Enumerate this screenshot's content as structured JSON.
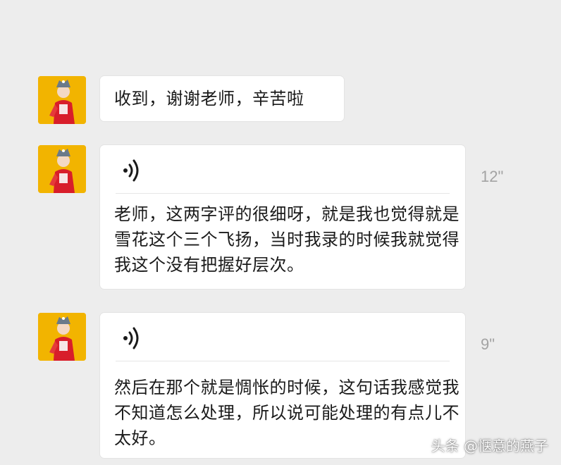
{
  "messages": [
    {
      "kind": "text",
      "text": "收到，谢谢老师，辛苦啦"
    },
    {
      "kind": "voice",
      "duration": "12\"",
      "transcript": [
        "老师，这两字评的很细呀，就是我也觉得就是",
        "雪花这个三个飞扬，当时我录的时候我就觉得",
        "我这个没有把握好层次。"
      ]
    },
    {
      "kind": "voice",
      "duration": "9\"",
      "transcript": [
        "然后在那个就是惆怅的时候，这句话我感觉我",
        "不知道怎么处理，所以说可能处理的有点儿不",
        "太好。"
      ]
    }
  ],
  "watermark": "头条 @惬意的燕子",
  "colors": {
    "background": "#ededed",
    "bubble": "#ffffff",
    "avatar_bg": "#f2b400",
    "duration_text": "#a3a3a3"
  },
  "icons": {
    "avatar": "avatar-image",
    "voice": "voice-wave-icon"
  }
}
